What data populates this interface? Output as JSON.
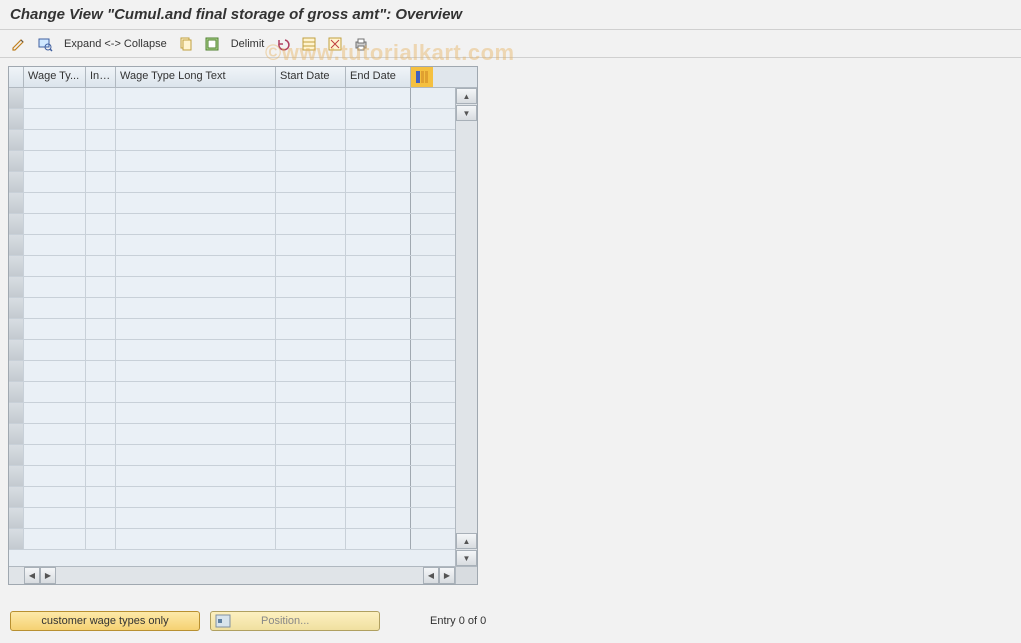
{
  "title": "Change View \"Cumul.and final storage of gross amt\": Overview",
  "toolbar": {
    "expand_collapse": "Expand <-> Collapse",
    "delimit": "Delimit"
  },
  "table": {
    "headers": {
      "wage_type": "Wage Ty...",
      "inf": "Inf...",
      "long_text": "Wage Type Long Text",
      "start_date": "Start Date",
      "end_date": "End Date"
    },
    "row_count": 22
  },
  "footer": {
    "customer_btn": "customer wage types only",
    "position_btn": "Position...",
    "entry_text": "Entry 0 of 0"
  },
  "watermark": "©www.tutorialkart.com"
}
